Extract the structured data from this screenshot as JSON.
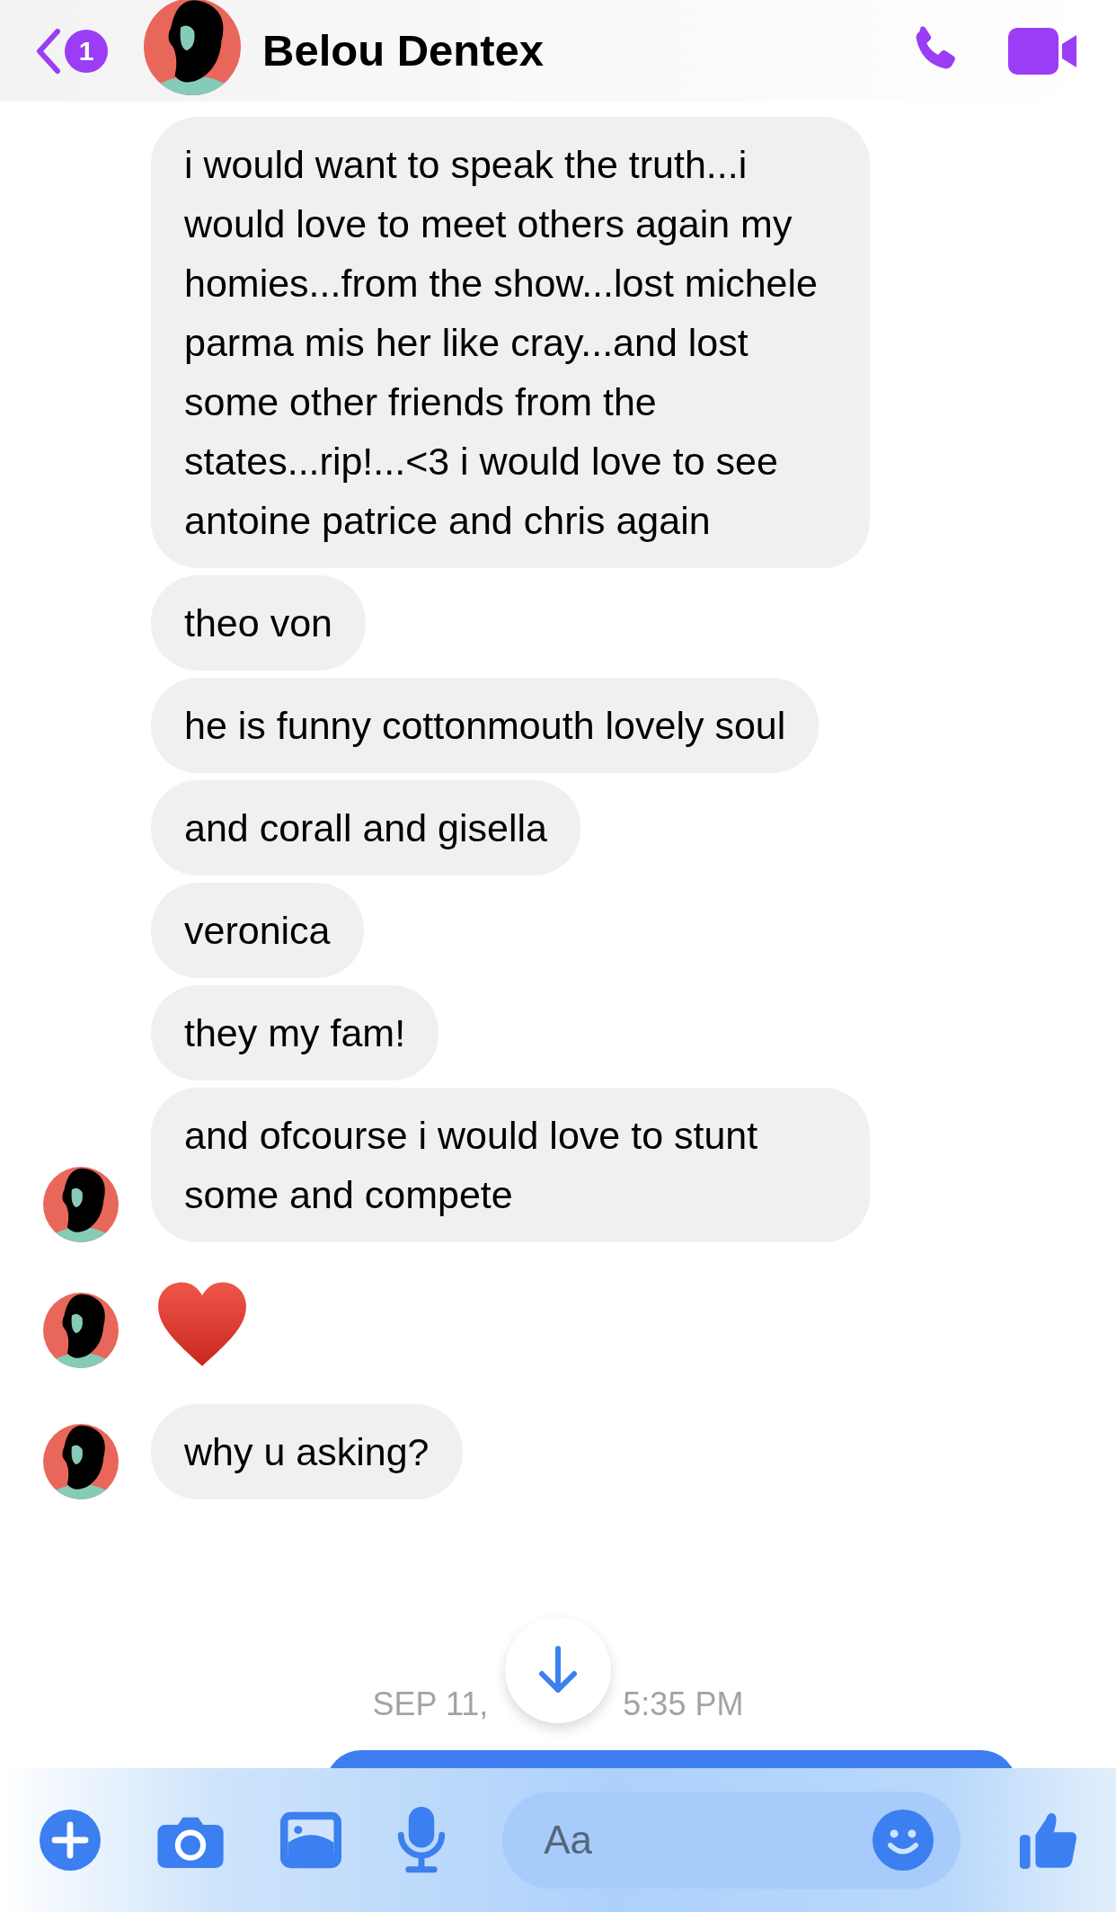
{
  "header": {
    "unread_count": "1",
    "contact_name": "Belou Dentex"
  },
  "messages": [
    {
      "kind": "text",
      "text": "i would want to speak the truth...i would love to meet others again my homies...from the show...lost michele parma mis her like cray...and lost some other friends from the states...rip!...<3 i would love to see antoine patrice and chris again",
      "show_avatar": false
    },
    {
      "kind": "text",
      "text": "theo von",
      "show_avatar": false
    },
    {
      "kind": "text",
      "text": "he is funny cottonmouth lovely soul",
      "show_avatar": false
    },
    {
      "kind": "text",
      "text": "and corall and gisella",
      "show_avatar": false
    },
    {
      "kind": "text",
      "text": "veronica",
      "show_avatar": false
    },
    {
      "kind": "text",
      "text": "they my fam!",
      "show_avatar": false
    },
    {
      "kind": "text",
      "text": "and ofcourse i would love to stunt some and compete",
      "show_avatar": true
    },
    {
      "kind": "heart",
      "show_avatar": true
    },
    {
      "kind": "text",
      "text": "why u asking?",
      "show_avatar": true
    }
  ],
  "timestamp": {
    "before": "SEP 11,",
    "after": "5:35 PM"
  },
  "composer": {
    "placeholder": "Aa"
  }
}
